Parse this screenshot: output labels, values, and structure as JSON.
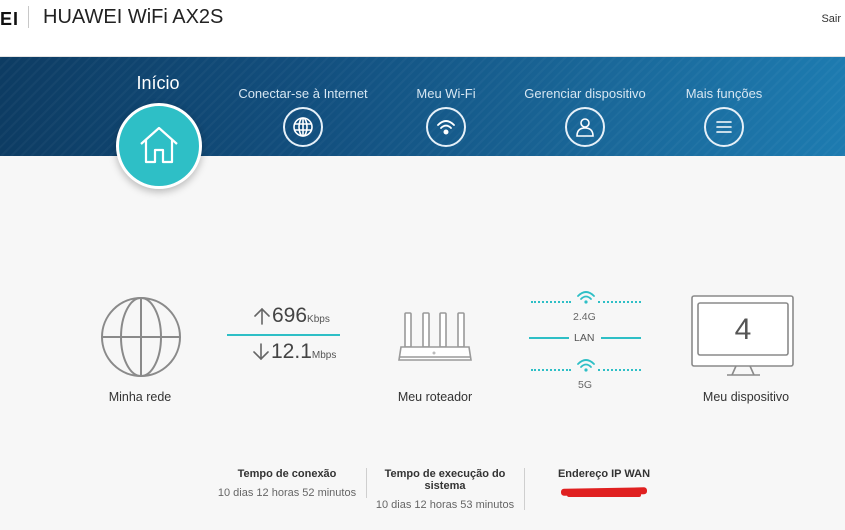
{
  "header": {
    "logo_fragment": "EI",
    "title": "HUAWEI WiFi AX2S",
    "logout": "Sair"
  },
  "nav": {
    "home": "Início",
    "items": [
      {
        "label": "Conectar-se à Internet",
        "icon": "globe-icon"
      },
      {
        "label": "Meu Wi-Fi",
        "icon": "wifi-icon"
      },
      {
        "label": "Gerenciar dispositivo",
        "icon": "user-icon"
      },
      {
        "label": "Mais funções",
        "icon": "menu-icon"
      }
    ]
  },
  "status": {
    "network_label": "Minha rede",
    "upload_value": "696",
    "upload_unit": "Kbps",
    "download_value": "12.1",
    "download_unit": "Mbps",
    "router_label": "Meu roteador",
    "band_24": "2.4G",
    "lan": "LAN",
    "band_5": "5G",
    "device_count": "4",
    "device_label": "Meu dispositivo"
  },
  "info": {
    "connection_time_title": "Tempo de conexão",
    "connection_time_value": "10 dias 12 horas 52 minutos",
    "uptime_title": "Tempo de execução do sistema",
    "uptime_value": "10 dias 12 horas 53 minutos",
    "wan_ip_title": "Endereço IP WAN"
  },
  "colors": {
    "accent": "#2ebfc6",
    "nav_dark": "#0d3c63",
    "nav_light": "#1d7bb0",
    "redaction": "#e02020"
  }
}
